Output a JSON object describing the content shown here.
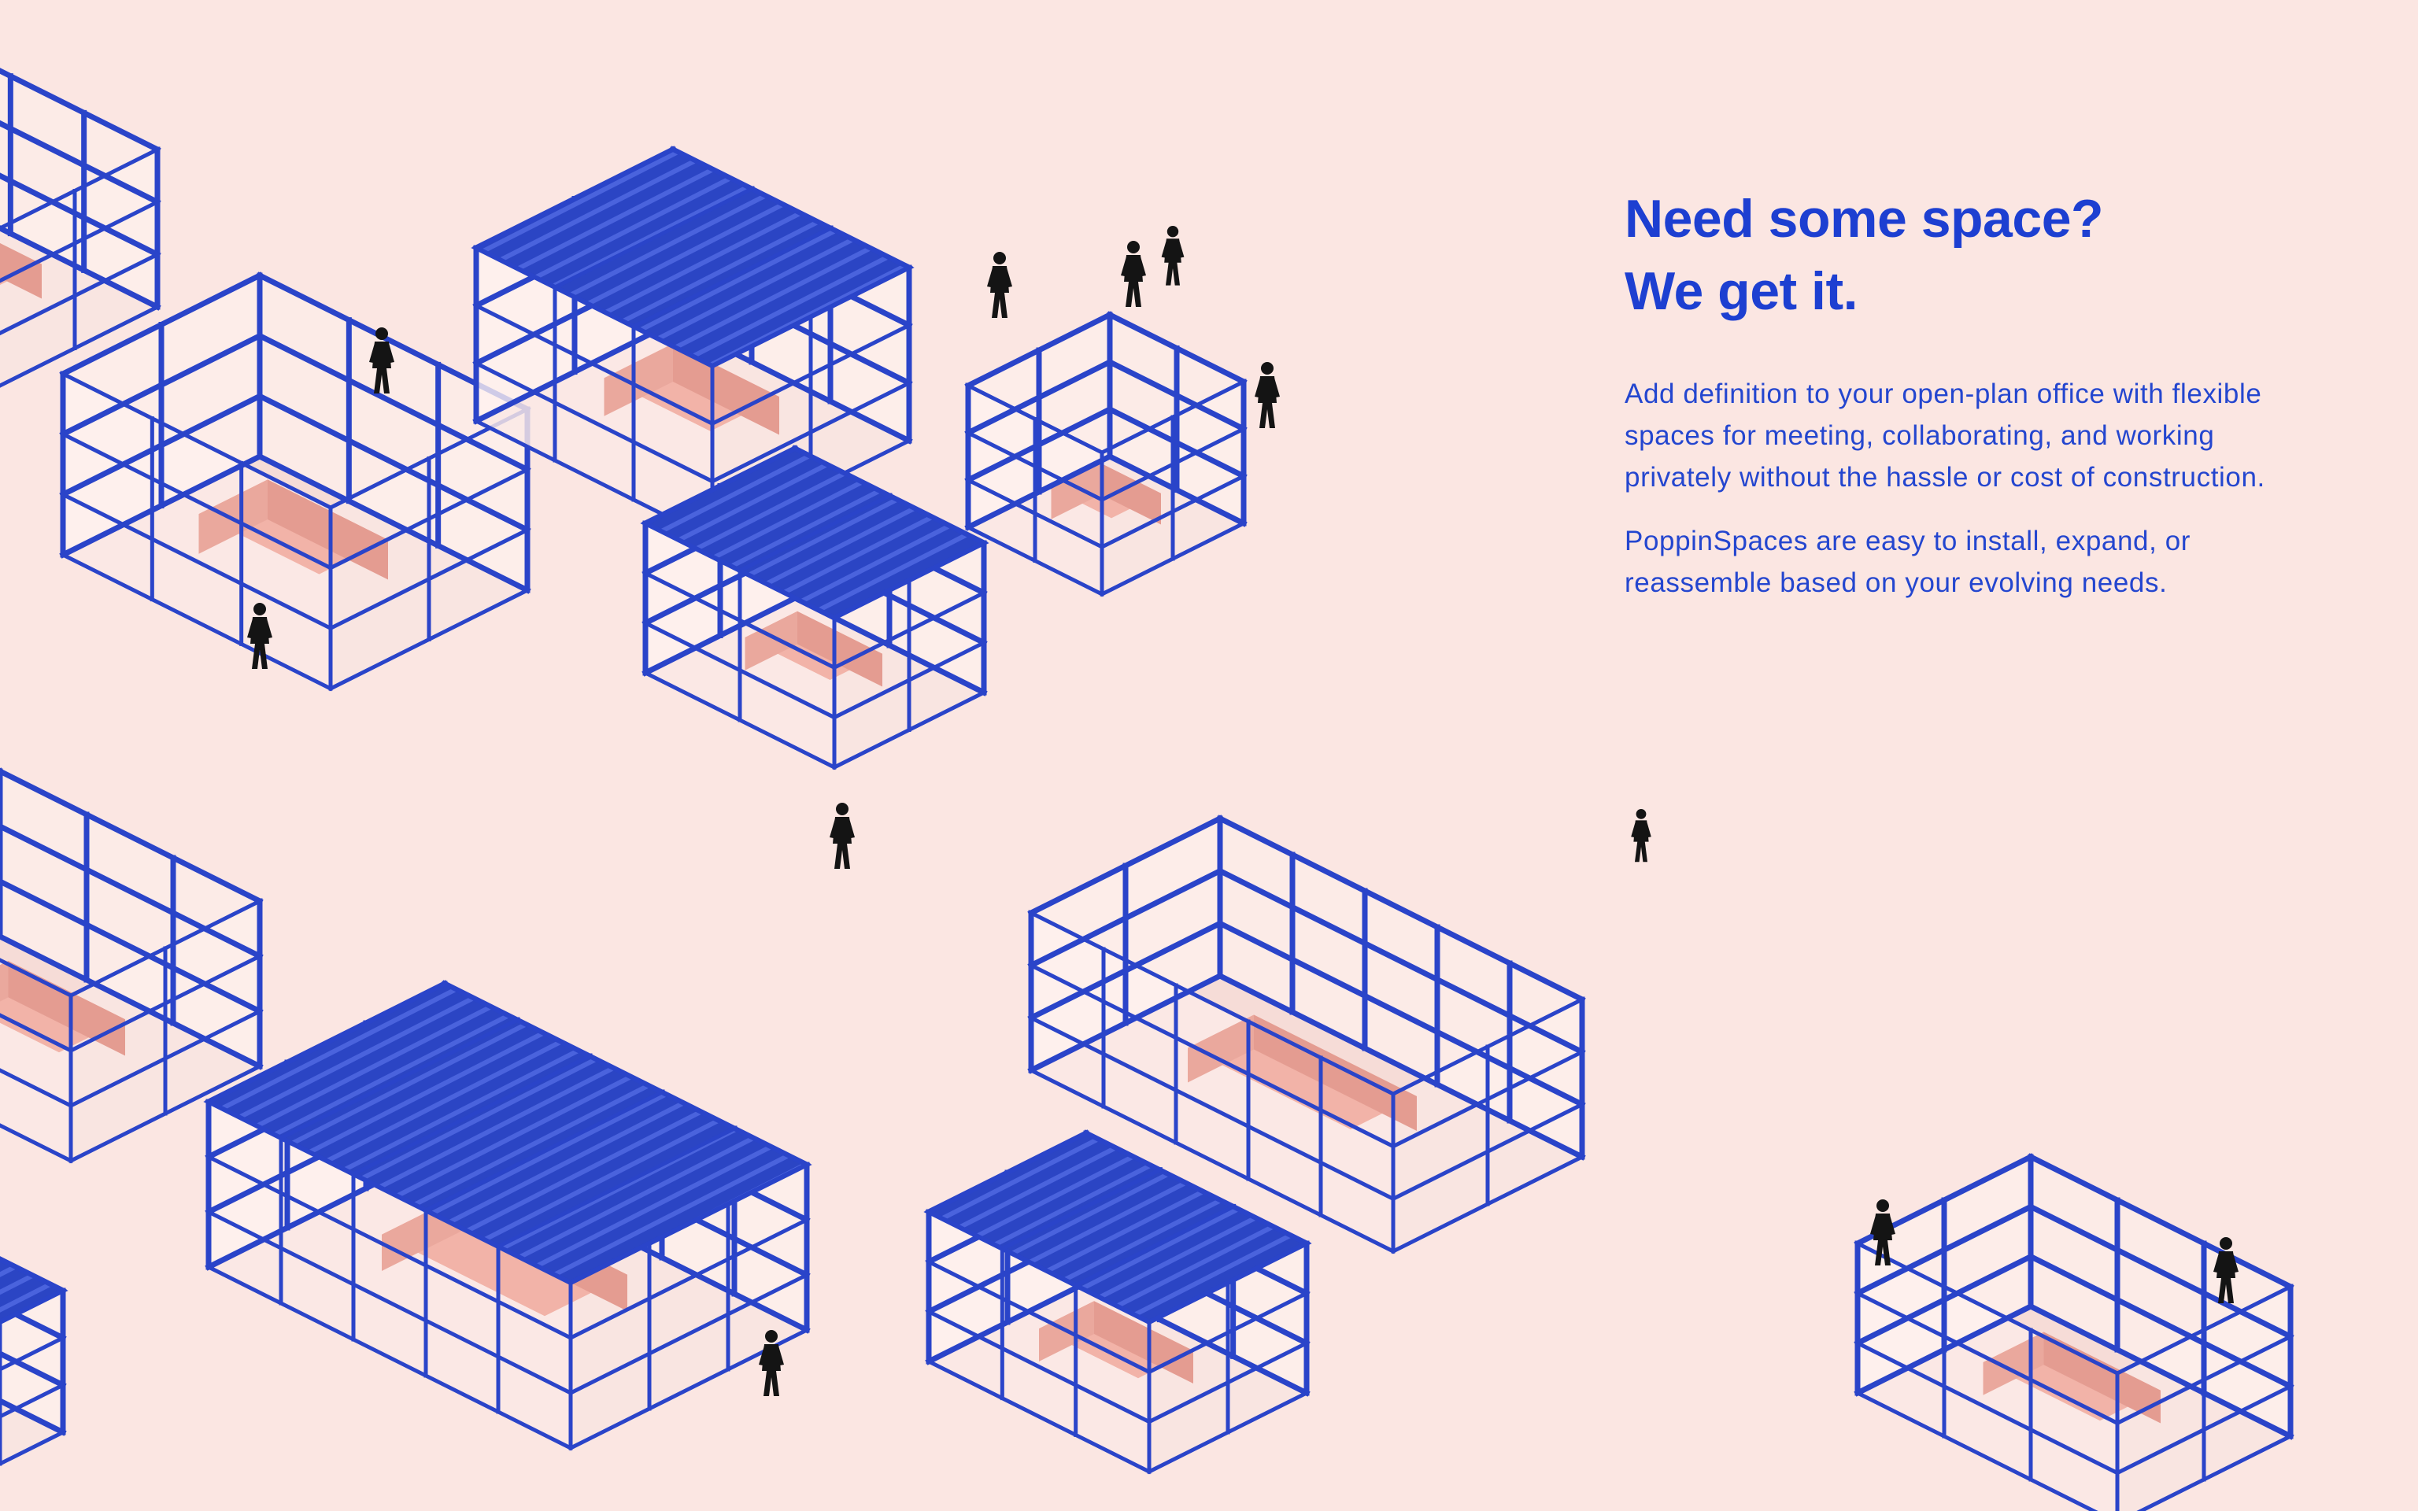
{
  "headline": {
    "line1": "Need some space?",
    "line2": "We get it."
  },
  "body": {
    "paragraph1": "Add definition to your open-plan office with flexible spaces for meeting, collaborating, and working privately without the hassle or cost of construction.",
    "paragraph2": "PoppinSpaces are easy to install, expand, or reassemble based on your evolving needs."
  },
  "colors": {
    "background": "#fbe6e2",
    "frame": "#2a44c9",
    "roof": "#2b45c4",
    "furniture": "#f2b3a8",
    "panel": "#fff3f0",
    "figure": "#141414",
    "text": "#1d3fd1"
  }
}
